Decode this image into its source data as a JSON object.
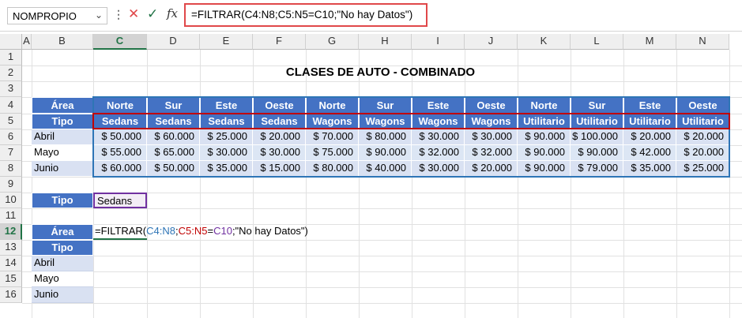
{
  "toolbar": {
    "name_box": "NOMPROPIO",
    "cancel_icon": "✕",
    "enter_icon": "✓",
    "fx_label": "fx",
    "formula": "=FILTRAR(C4:N8;C5:N5=C10;\"No hay Datos\")"
  },
  "columns": [
    "A",
    "B",
    "C",
    "D",
    "E",
    "F",
    "G",
    "H",
    "I",
    "J",
    "K",
    "L",
    "M",
    "N"
  ],
  "rows": [
    "1",
    "2",
    "3",
    "4",
    "5",
    "6",
    "7",
    "8",
    "9",
    "10",
    "11",
    "12",
    "13",
    "14",
    "15",
    "16"
  ],
  "title": "CLASES DE AUTO - COMBINADO",
  "table": {
    "area_label": "Área",
    "tipo_label": "Tipo",
    "areas": [
      "Norte",
      "Sur",
      "Este",
      "Oeste",
      "Norte",
      "Sur",
      "Este",
      "Oeste",
      "Norte",
      "Sur",
      "Este",
      "Oeste"
    ],
    "tipos": [
      "Sedans",
      "Sedans",
      "Sedans",
      "Sedans",
      "Wagons",
      "Wagons",
      "Wagons",
      "Wagons",
      "Utilitario",
      "Utilitario",
      "Utilitario",
      "Utilitario"
    ],
    "months": [
      "Abril",
      "Mayo",
      "Junio"
    ],
    "values": [
      [
        "$ 50.000",
        "$ 60.000",
        "$ 25.000",
        "$ 20.000",
        "$ 70.000",
        "$ 80.000",
        "$ 30.000",
        "$ 30.000",
        "$ 90.000",
        "$ 100.000",
        "$ 20.000",
        "$ 20.000"
      ],
      [
        "$ 55.000",
        "$ 65.000",
        "$ 30.000",
        "$ 30.000",
        "$ 75.000",
        "$ 90.000",
        "$ 32.000",
        "$ 32.000",
        "$ 90.000",
        "$ 90.000",
        "$ 42.000",
        "$ 20.000"
      ],
      [
        "$ 60.000",
        "$ 50.000",
        "$ 35.000",
        "$ 15.000",
        "$ 80.000",
        "$ 40.000",
        "$ 30.000",
        "$ 20.000",
        "$ 90.000",
        "$ 79.000",
        "$ 35.000",
        "$ 25.000"
      ]
    ]
  },
  "criteria": {
    "label": "Tipo",
    "value": "Sedans"
  },
  "result": {
    "area_label": "Área",
    "tipo_label": "Tipo",
    "months": [
      "Abril",
      "Mayo",
      "Junio"
    ],
    "formula_parts": [
      "=FILTRAR(",
      "C4:N8",
      ";",
      "C5:N5",
      "=",
      "C10",
      ";\"No hay Datos\")"
    ]
  },
  "colors": {
    "header_blue": "#4472c4",
    "light_blue": "#d9e1f2",
    "ref_blue": "#2e75b6",
    "ref_red": "#c00000",
    "ref_purple": "#7030a0",
    "excel_green": "#217346"
  }
}
